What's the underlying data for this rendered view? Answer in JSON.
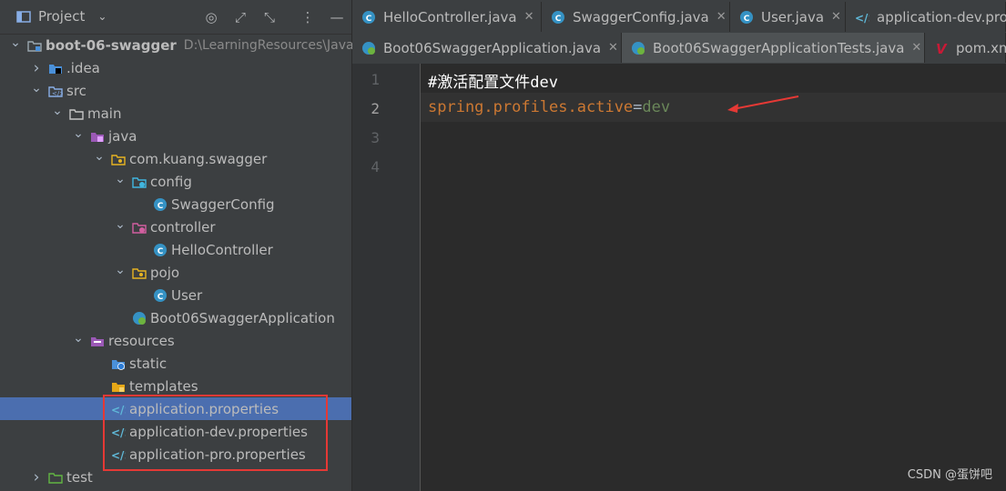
{
  "project_panel": {
    "title": "Project",
    "tree": [
      {
        "label": "boot-06-swagger",
        "path": "D:\\LearningResources\\Java",
        "expanded": true,
        "icon": "module-folder-icon"
      },
      {
        "label": ".idea",
        "expanded": false,
        "icon": "idea-folder-icon"
      },
      {
        "label": "src",
        "expanded": true,
        "icon": "source-folder-icon"
      },
      {
        "label": "main",
        "expanded": true,
        "icon": "folder-icon"
      },
      {
        "label": "java",
        "expanded": true,
        "icon": "java-source-folder-icon"
      },
      {
        "label": "com.kuang.swagger",
        "expanded": true,
        "icon": "package-icon"
      },
      {
        "label": "config",
        "expanded": true,
        "icon": "config-package-icon"
      },
      {
        "label": "SwaggerConfig",
        "icon": "class-icon"
      },
      {
        "label": "controller",
        "expanded": true,
        "icon": "controller-package-icon"
      },
      {
        "label": "HelloController",
        "icon": "class-icon"
      },
      {
        "label": "pojo",
        "expanded": true,
        "icon": "package-icon"
      },
      {
        "label": "User",
        "icon": "class-icon"
      },
      {
        "label": "Boot06SwaggerApplication",
        "icon": "spring-boot-class-icon"
      },
      {
        "label": "resources",
        "expanded": true,
        "icon": "resources-folder-icon"
      },
      {
        "label": "static",
        "icon": "web-folder-icon"
      },
      {
        "label": "templates",
        "icon": "templates-folder-icon"
      },
      {
        "label": "application.properties",
        "icon": "properties-file-icon",
        "selected": true
      },
      {
        "label": "application-dev.properties",
        "icon": "properties-file-icon"
      },
      {
        "label": "application-pro.properties",
        "icon": "properties-file-icon"
      },
      {
        "label": "test",
        "expanded": false,
        "icon": "test-folder-icon"
      }
    ]
  },
  "tabs_row1": [
    {
      "label": "HelloController.java",
      "icon": "class-icon",
      "close": "✕"
    },
    {
      "label": "SwaggerConfig.java",
      "icon": "class-icon",
      "close": "✕"
    },
    {
      "label": "User.java",
      "icon": "class-icon",
      "close": "✕"
    },
    {
      "label": "application-dev.pro",
      "icon": "properties-file-icon"
    }
  ],
  "tabs_row2": [
    {
      "label": "Boot06SwaggerApplication.java",
      "icon": "spring-boot-class-icon",
      "close": "✕"
    },
    {
      "label": "Boot06SwaggerApplicationTests.java",
      "icon": "spring-boot-class-icon",
      "close": "✕",
      "active": true
    },
    {
      "label": "pom.xm",
      "icon": "maven-icon"
    }
  ],
  "editor": {
    "line_numbers": [
      "1",
      "2",
      "3",
      "4"
    ],
    "comment": "#激活配置文件dev",
    "key": "spring.profiles.active",
    "equals": "=",
    "value": "dev"
  },
  "watermark": "CSDN @蛋饼吧",
  "colors": {
    "selection": "#4b6eaf",
    "highlight_box": "#e53935",
    "key_color": "#cc7832",
    "value_color": "#6a8759"
  }
}
